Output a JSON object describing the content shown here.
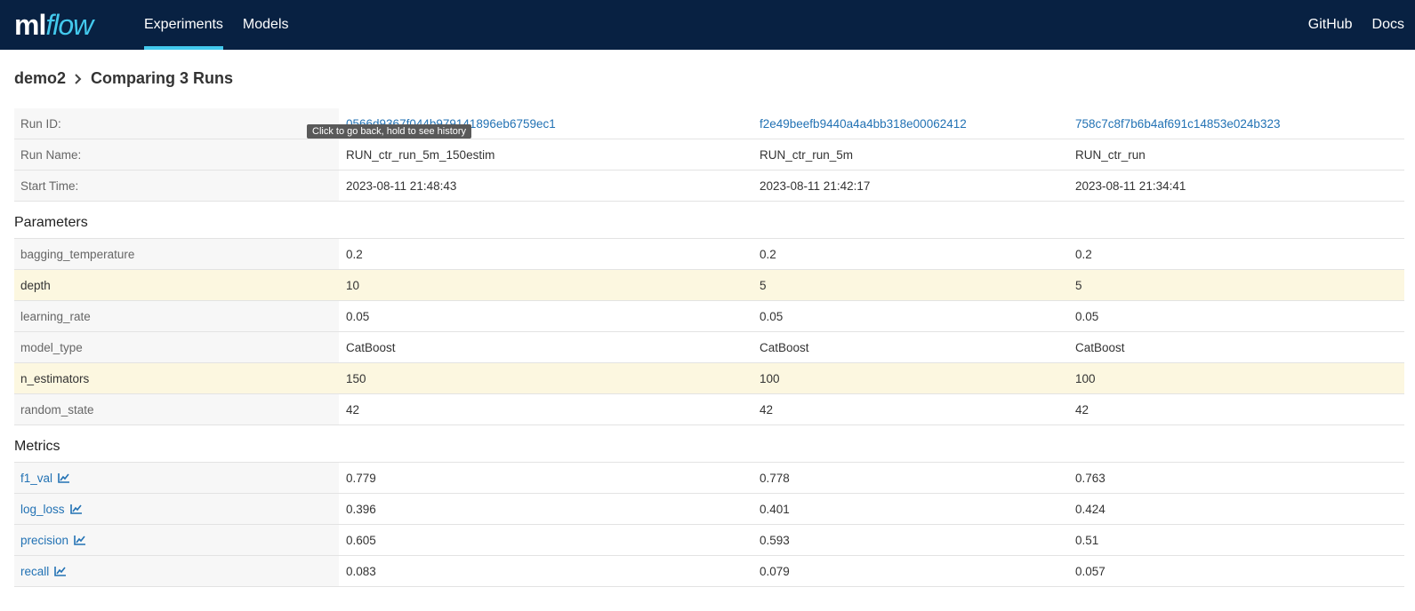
{
  "header": {
    "logo_ml": "ml",
    "logo_flow": "flow",
    "tabs": [
      {
        "label": "Experiments",
        "active": true
      },
      {
        "label": "Models",
        "active": false
      }
    ],
    "right_links": [
      "GitHub",
      "Docs"
    ],
    "colors": {
      "bar": "#082142",
      "accent": "#43c9ed"
    }
  },
  "breadcrumb": {
    "experiment": "demo2",
    "separator_icon": "chevron-right-icon",
    "title": "Comparing 3 Runs"
  },
  "tooltip": "Click to go back, hold to see history",
  "runs": {
    "run_id_label": "Run ID:",
    "run_name_label": "Run Name:",
    "start_time_label": "Start Time:",
    "ids": [
      "0566d9367f044b979141896eb6759ec1",
      "f2e49beefb9440a4a4bb318e00062412",
      "758c7c8f7b6b4af691c14853e024b323"
    ],
    "names": [
      "RUN_ctr_run_5m_150estim",
      "RUN_ctr_run_5m",
      "RUN_ctr_run"
    ],
    "start_times": [
      "2023-08-11 21:48:43",
      "2023-08-11 21:42:17",
      "2023-08-11 21:34:41"
    ]
  },
  "parameters": {
    "title": "Parameters",
    "rows": [
      {
        "name": "bagging_temperature",
        "values": [
          "0.2",
          "0.2",
          "0.2"
        ],
        "diff": false
      },
      {
        "name": "depth",
        "values": [
          "10",
          "5",
          "5"
        ],
        "diff": true
      },
      {
        "name": "learning_rate",
        "values": [
          "0.05",
          "0.05",
          "0.05"
        ],
        "diff": false
      },
      {
        "name": "model_type",
        "values": [
          "CatBoost",
          "CatBoost",
          "CatBoost"
        ],
        "diff": false
      },
      {
        "name": "n_estimators",
        "values": [
          "150",
          "100",
          "100"
        ],
        "diff": true
      },
      {
        "name": "random_state",
        "values": [
          "42",
          "42",
          "42"
        ],
        "diff": false
      }
    ]
  },
  "metrics": {
    "title": "Metrics",
    "icon": "line-chart-icon",
    "rows": [
      {
        "name": "f1_val",
        "values": [
          "0.779",
          "0.778",
          "0.763"
        ]
      },
      {
        "name": "log_loss",
        "values": [
          "0.396",
          "0.401",
          "0.424"
        ]
      },
      {
        "name": "precision",
        "values": [
          "0.605",
          "0.593",
          "0.51"
        ]
      },
      {
        "name": "recall",
        "values": [
          "0.083",
          "0.079",
          "0.057"
        ]
      }
    ]
  }
}
